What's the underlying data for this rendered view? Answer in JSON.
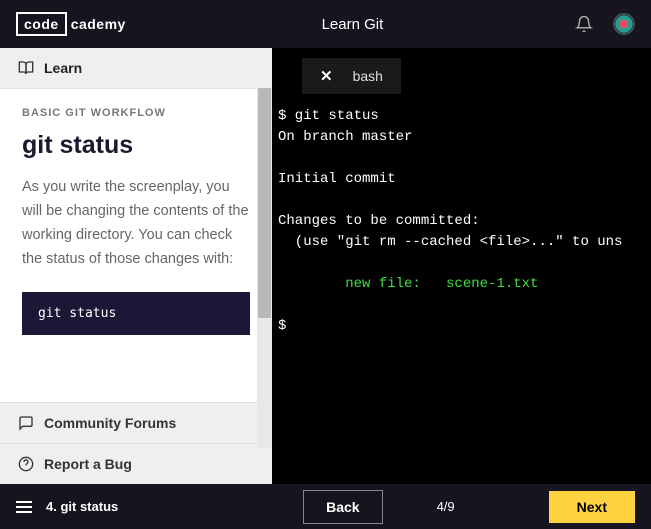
{
  "header": {
    "logo_boxed": "code",
    "logo_rest": "cademy",
    "title": "Learn Git"
  },
  "sidebar": {
    "learn_tab": "Learn",
    "category": "BASIC GIT WORKFLOW",
    "title": "git status",
    "description": "As you write the screenplay, you will be changing the contents of the working directory. You can check the status of those changes with:",
    "code": "git status",
    "community": "Community Forums",
    "report": "Report a Bug"
  },
  "terminal": {
    "tab_label": "bash",
    "line1": "$ git status",
    "line2": "On branch master",
    "line3": "Initial commit",
    "line4": "Changes to be committed:",
    "line5": "  (use \"git rm --cached <file>...\" to uns",
    "line6": "        new file:   scene-1.txt",
    "line7": "$"
  },
  "footer": {
    "lesson_label": "4. git status",
    "back": "Back",
    "progress": "4/9",
    "next": "Next"
  }
}
